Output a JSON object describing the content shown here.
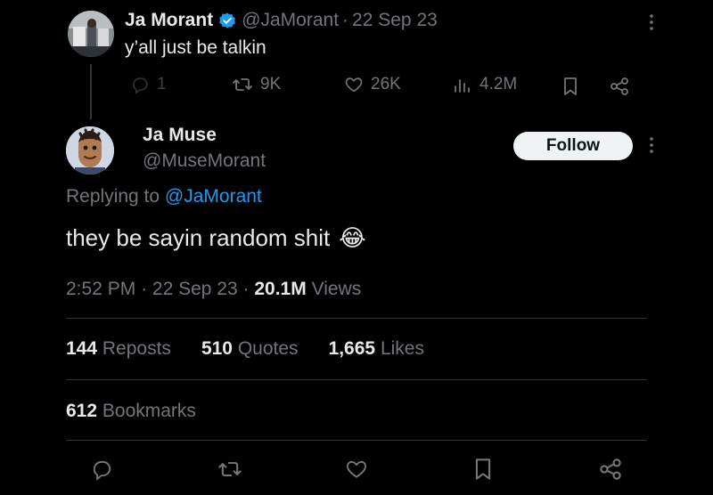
{
  "parent_tweet": {
    "author_name": "Ja Morant",
    "handle": "@JaMorant",
    "separator": "·",
    "date": "22 Sep 23",
    "text": "y’all just be talkin",
    "verified": true,
    "accent": "#1d9bf0",
    "actions": {
      "replies": "1",
      "reposts": "9K",
      "likes": "26K",
      "views": "4.2M"
    },
    "icons": [
      "reply-icon",
      "repost-icon",
      "like-icon",
      "views-icon",
      "bookmark-icon",
      "share-icon",
      "more-icon"
    ]
  },
  "main_tweet": {
    "author_name": "Ja Muse",
    "handle": "@MuseMorant",
    "follow_label": "Follow",
    "replying_prefix": "Replying to",
    "replying_handle": "@JaMorant",
    "text": "they be sayin random shit",
    "emoji": "😂",
    "time": "2:52 PM",
    "date": "22 Sep 23",
    "separator": "·",
    "views_count": "20.1M",
    "views_label": "Views",
    "stats": {
      "reposts_count": "144",
      "reposts_label": "Reposts",
      "quotes_count": "510",
      "quotes_label": "Quotes",
      "likes_count": "1,665",
      "likes_label": "Likes",
      "bookmarks_count": "612",
      "bookmarks_label": "Bookmarks"
    },
    "action_icons": [
      "reply-icon",
      "repost-icon",
      "like-icon",
      "bookmark-icon",
      "share-icon"
    ]
  },
  "colors": {
    "background": "#000000",
    "text": "#e7e9ea",
    "muted": "#71767b",
    "link": "#1d9bf0",
    "divider": "#2f3336"
  }
}
